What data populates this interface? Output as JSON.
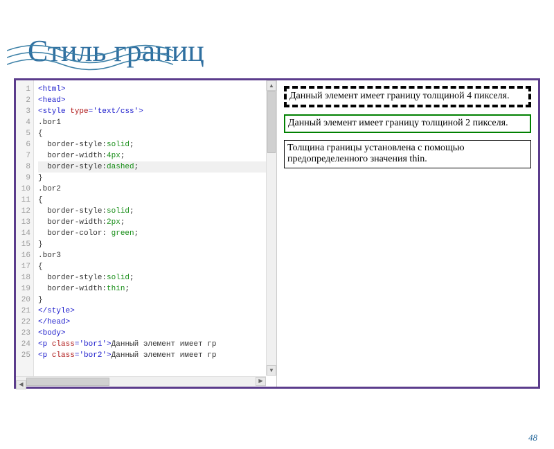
{
  "title": "Стиль границ",
  "page": "48",
  "code_lines": [
    {
      "n": "1",
      "raw": "<html>",
      "cls": "tag"
    },
    {
      "n": "2",
      "raw": "<head>",
      "cls": "tag"
    },
    {
      "n": "3",
      "segs": [
        {
          "t": "<style ",
          "c": "tag"
        },
        {
          "t": "type",
          "c": "attr"
        },
        {
          "t": "=",
          "c": "tag"
        },
        {
          "t": "'text/css'",
          "c": "str"
        },
        {
          "t": ">",
          "c": "tag"
        }
      ]
    },
    {
      "n": "4",
      "raw": ".bor1",
      "cls": "css"
    },
    {
      "n": "5",
      "raw": "{",
      "cls": "css"
    },
    {
      "n": "6",
      "segs": [
        {
          "t": "  border-style:",
          "c": "css"
        },
        {
          "t": "solid",
          "c": "cssv"
        },
        {
          "t": ";",
          "c": "css"
        }
      ]
    },
    {
      "n": "7",
      "segs": [
        {
          "t": "  border-width:",
          "c": "css"
        },
        {
          "t": "4px",
          "c": "cssv"
        },
        {
          "t": ";",
          "c": "css"
        }
      ]
    },
    {
      "n": "8",
      "segs": [
        {
          "t": "  border-style:",
          "c": "css"
        },
        {
          "t": "dashed",
          "c": "cssv"
        },
        {
          "t": ";",
          "c": "css"
        }
      ],
      "hl": true
    },
    {
      "n": "9",
      "raw": "}",
      "cls": "css"
    },
    {
      "n": "10",
      "raw": ".bor2",
      "cls": "css"
    },
    {
      "n": "11",
      "raw": "{",
      "cls": "css"
    },
    {
      "n": "12",
      "segs": [
        {
          "t": "  border-style:",
          "c": "css"
        },
        {
          "t": "solid",
          "c": "cssv"
        },
        {
          "t": ";",
          "c": "css"
        }
      ]
    },
    {
      "n": "13",
      "segs": [
        {
          "t": "  border-width:",
          "c": "css"
        },
        {
          "t": "2px",
          "c": "cssv"
        },
        {
          "t": ";",
          "c": "css"
        }
      ]
    },
    {
      "n": "14",
      "segs": [
        {
          "t": "  border-color: ",
          "c": "css"
        },
        {
          "t": "green",
          "c": "cssv"
        },
        {
          "t": ";",
          "c": "css"
        }
      ]
    },
    {
      "n": "15",
      "raw": "}",
      "cls": "css"
    },
    {
      "n": "16",
      "raw": ".bor3",
      "cls": "css"
    },
    {
      "n": "17",
      "raw": "{",
      "cls": "css"
    },
    {
      "n": "18",
      "segs": [
        {
          "t": "  border-style:",
          "c": "css"
        },
        {
          "t": "solid",
          "c": "cssv"
        },
        {
          "t": ";",
          "c": "css"
        }
      ]
    },
    {
      "n": "19",
      "segs": [
        {
          "t": "  border-width:",
          "c": "css"
        },
        {
          "t": "thin",
          "c": "cssv"
        },
        {
          "t": ";",
          "c": "css"
        }
      ]
    },
    {
      "n": "20",
      "raw": "}",
      "cls": "css"
    },
    {
      "n": "21",
      "raw": "</style>",
      "cls": "tag"
    },
    {
      "n": "22",
      "raw": "</head>",
      "cls": "tag"
    },
    {
      "n": "23",
      "raw": "<body>",
      "cls": "tag"
    },
    {
      "n": "24",
      "segs": [
        {
          "t": "<p ",
          "c": "tag"
        },
        {
          "t": "class",
          "c": "attr"
        },
        {
          "t": "=",
          "c": "tag"
        },
        {
          "t": "'bor1'",
          "c": "str"
        },
        {
          "t": ">",
          "c": "tag"
        },
        {
          "t": "Данный элемент имеет гр",
          "c": "css"
        }
      ]
    },
    {
      "n": "25",
      "segs": [
        {
          "t": "<p ",
          "c": "tag"
        },
        {
          "t": "class",
          "c": "attr"
        },
        {
          "t": "=",
          "c": "tag"
        },
        {
          "t": "'bor2'",
          "c": "str"
        },
        {
          "t": ">",
          "c": "tag"
        },
        {
          "t": "Данный элемент имеет гр",
          "c": "css"
        }
      ]
    }
  ],
  "preview": {
    "box1": "Данный элемент имеет границу толщиной 4 пикселя.",
    "box2": "Данный элемент имеет границу толщиной 2 пикселя.",
    "box3": "Толщина границы установлена с помощью предопределенного значения thin."
  }
}
